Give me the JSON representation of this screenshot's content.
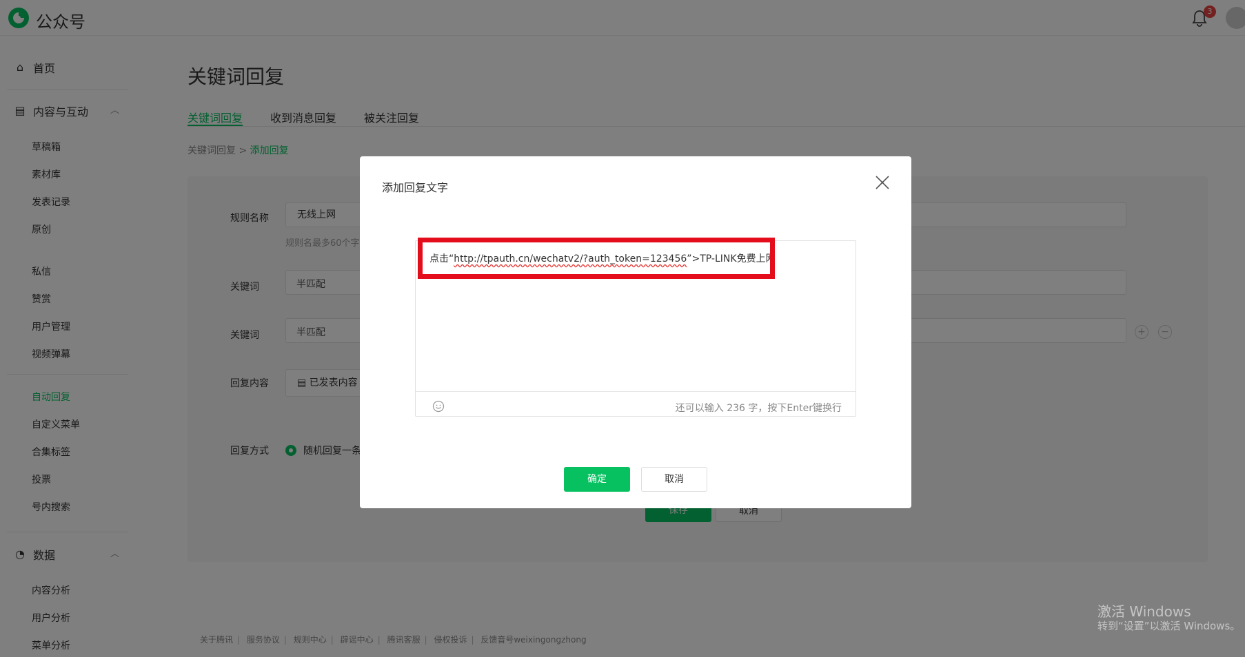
{
  "header": {
    "brand": "公众号",
    "notifications_count": "3"
  },
  "sidebar": {
    "home": "首页",
    "content_section": "内容与互动",
    "content_items": [
      "草稿箱",
      "素材库",
      "发表记录",
      "原创"
    ],
    "interaction_items": [
      "私信",
      "赞赏",
      "用户管理",
      "视频弹幕"
    ],
    "feature_items": [
      "自动回复",
      "自定义菜单",
      "合集标签",
      "投票",
      "号内搜索"
    ],
    "active_item": "自动回复",
    "data_section": "数据",
    "data_items": [
      "内容分析",
      "用户分析",
      "菜单分析"
    ]
  },
  "main": {
    "title": "关键词回复",
    "tabs": [
      "关键词回复",
      "收到消息回复",
      "被关注回复"
    ],
    "breadcrumb_parent": "关键词回复",
    "breadcrumb_sep": " > ",
    "breadcrumb_current": "添加回复",
    "form": {
      "rule_name_label": "规则名称",
      "rule_name_value": "无线上网",
      "rule_name_hint": "规则名最多60个字",
      "keyword_label": "关键词",
      "match_mode": "半匹配",
      "reply_content_label": "回复内容",
      "reply_content_option": "已发表内容",
      "reply_mode_label": "回复方式",
      "reply_mode_value": "随机回复一条",
      "save": "保存",
      "cancel": "取消"
    }
  },
  "footer": [
    "关于腾讯",
    "服务协议",
    "规则中心",
    "辟谣中心",
    "腾讯客服",
    "侵权投诉",
    "反馈音号weixingongzhong"
  ],
  "modal": {
    "title": "添加回复文字",
    "editor_prefix": "点击“",
    "editor_link": "http://tpauth.cn/wechatv2/?auth_token=123456",
    "editor_suffix": "”>TP-LINK免费上网",
    "counter": "还可以输入 236 字，按下Enter键换行",
    "confirm": "确定",
    "cancel": "取消"
  },
  "watermark": {
    "line1": "激活 Windows",
    "line2": "转到“设置”以激活 Windows。"
  },
  "colors": {
    "accent": "#07c160",
    "highlight": "#e30d1b",
    "badge": "#e64340"
  }
}
